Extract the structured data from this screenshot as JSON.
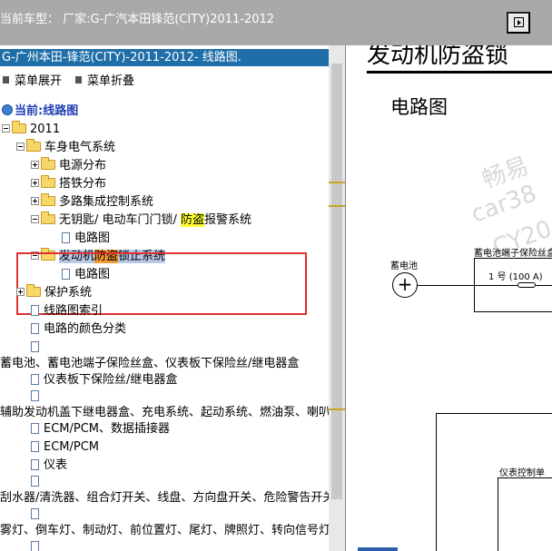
{
  "topbar": {
    "title": "当前车型：  厂家:G-广汽本田锋范(CITY)2011-2012"
  },
  "tree": {
    "header": "G-广州本田-锋范(CITY)-2011-2012- 线路图.",
    "expand_all": "菜单展开",
    "collapse_all": "菜单折叠",
    "current_label": "当前:线路图",
    "nodes": {
      "year": "2011",
      "body_electrical": "车身电气系统",
      "power_distribution": "电源分布",
      "ground_distribution": "搭铁分布",
      "multiplex": "多路集成控制系统",
      "keyless_prefix": "无钥匙/ 电动车门门锁/ ",
      "keyless_highlight": "防盗",
      "keyless_suffix": "报警系统",
      "circuit_1": "电路图",
      "immobilizer_prefix": "发动机",
      "immobilizer_highlight": "防盗",
      "immobilizer_suffix": "锁止系统",
      "circuit_2": "电路图",
      "protection": "保护系统",
      "circuit_index": "线路图索引",
      "wire_colors": "电路的颜色分类",
      "battery_fuse": "蓄电池、蓄电池端子保险丝盒、仪表板下保险丝/继电器盒",
      "dash_fuse": "仪表板下保险丝/继电器盒",
      "aux_relay": "辅助发动机盖下继电器盒、充电系统、起动系统、燃油泵、喇叭",
      "ecm_dlc": "ECM/PCM、数据插接器",
      "ecm": "ECM/PCM",
      "gauges": "仪表",
      "wiper": "刮水器/清洗器、组合灯开关、线盘、方向盘开关、危险警告开关",
      "lights": "雾灯、倒车灯、制动灯、前位置灯、尾灯、牌照灯、转向信号灯"
    }
  },
  "document": {
    "title": "发动机防盗锁",
    "subtitle": "电路图",
    "watermark_1": "畅易",
    "watermark_2": "car38",
    "watermark_3": "CY20",
    "battery_label": "蓄电池",
    "fuse_box_label": "蓄电池端子保险丝盒",
    "fuse_label": "1 号 (100 A)",
    "dash_label": "仪表控制单"
  }
}
